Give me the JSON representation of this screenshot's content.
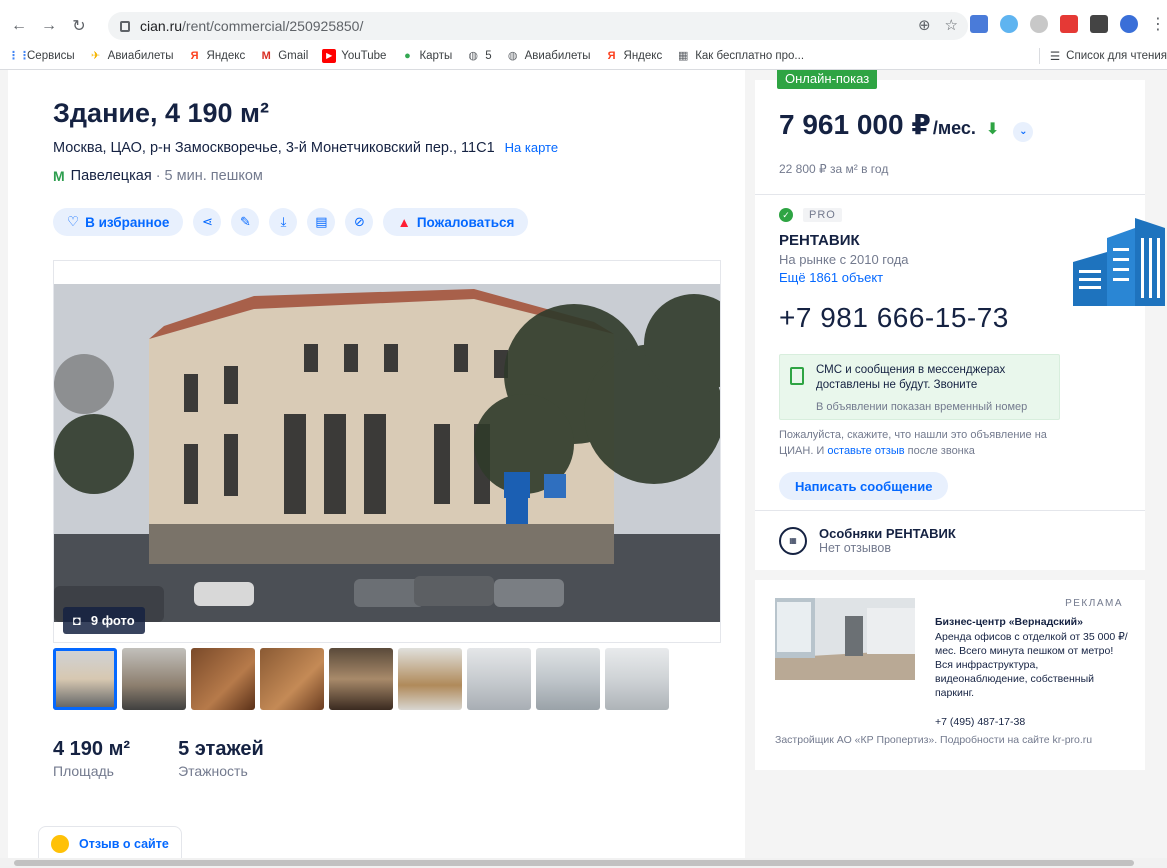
{
  "browser": {
    "url_host": "cian.ru",
    "url_path": "/rent/commercial/250925850/",
    "bookmarks": [
      {
        "label": "Сервисы"
      },
      {
        "label": "Авиабилеты"
      },
      {
        "label": "Яндекс"
      },
      {
        "label": "Gmail"
      },
      {
        "label": "YouTube"
      },
      {
        "label": "Карты"
      },
      {
        "label": "5"
      },
      {
        "label": "Авиабилеты"
      },
      {
        "label": "Яндекс"
      },
      {
        "label": "Как бесплатно про..."
      }
    ],
    "reading_list": "Список для чтения"
  },
  "listing": {
    "title": "Здание, 4 190 м²",
    "address": "Москва, ЦАО, р-н Замоскворечье, 3-й Монетчиковский пер., 11С1",
    "map_link": "На карте",
    "metro_station": "Павелецкая",
    "metro_walk": "· 5 мин. пешком",
    "actions": {
      "favorite": "В избранное",
      "report": "Пожаловаться"
    },
    "photo_count": "9 фото",
    "stats": [
      {
        "value": "4 190 м²",
        "label": "Площадь"
      },
      {
        "value": "5 этажей",
        "label": "Этажность"
      }
    ],
    "feedback": "Отзыв о сайте"
  },
  "sidebar": {
    "online_badge": "Онлайн-показ",
    "price": "7 961 000 ₽",
    "price_period": "/мес.",
    "price_per_m2": "22 800 ₽ за м² в год",
    "pro_label": "PRO",
    "agency_name": "РЕНТАВИК",
    "on_market": "На рынке с 2010 года",
    "more_objects": "Ещё 1861 объект",
    "phone": "+7 981 666-15-73",
    "notice_main": "СМС и сообщения в мессенджерах доставлены не будут. Звоните",
    "notice_sub": "В объявлении показан временный номер",
    "please_pre": "Пожалуйста, скажите, что нашли это объявление на ЦИАН. И ",
    "please_link": "оставьте отзыв",
    "please_post": " после звонка",
    "write_message": "Написать сообщение",
    "agent_name": "Особняки РЕНТАВИК",
    "agent_reviews": "Нет отзывов"
  },
  "ad": {
    "label": "РЕКЛАМА",
    "title": "Бизнес-центр «Вернадский»",
    "description": "Аренда офисов с отделкой от 35 000 ₽/мес. Всего минута пешком от метро! Вся инфраструктура, видеонаблюдение, собственный паркинг.",
    "phone": "+7 (495) 487-17-38",
    "footer": "Застройщик АО «КР Пропертиз». Подробности на сайте kr-pro.ru"
  },
  "colors": {
    "accent": "#0468ff",
    "green": "#2ea443",
    "text": "#152242",
    "muted": "#737a8e"
  }
}
